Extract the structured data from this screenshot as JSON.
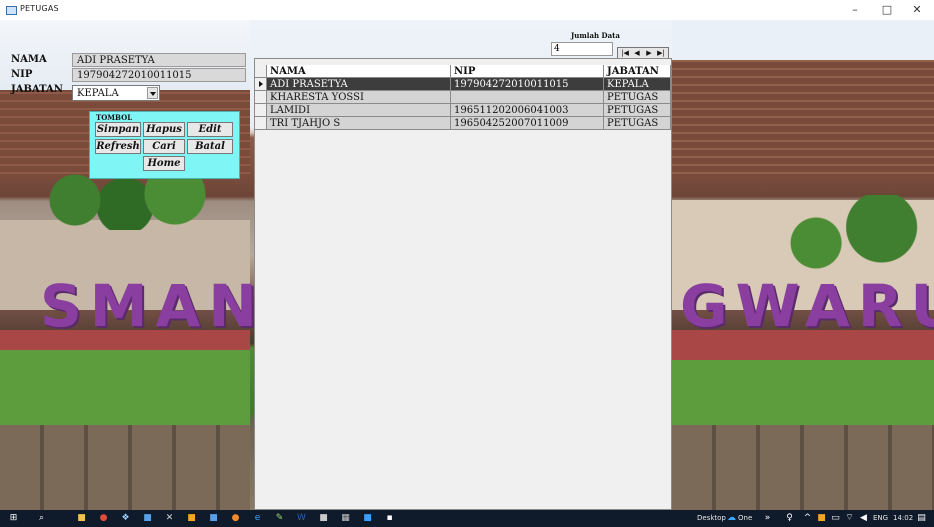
{
  "window": {
    "title": "PETUGAS"
  },
  "form": {
    "nama_label": "NAMA",
    "nama_value": "ADI PRASETYA",
    "nip_label": "NIP",
    "nip_value": "197904272010011015",
    "jabatan_label": "JABATAN",
    "jabatan_value": "KEPALA"
  },
  "tombol": {
    "caption": "TOMBOL",
    "simpan": "Simpan",
    "hapus": "Hapus",
    "edit": "Edit",
    "refresh": "Refresh",
    "cari": "Cari",
    "batal": "Batal",
    "home": "Home"
  },
  "jumlah": {
    "label": "Jumlah Data",
    "value": "4"
  },
  "grid": {
    "headers": [
      "NAMA",
      "NIP",
      "JABATAN"
    ],
    "rows": [
      [
        "ADI PRASETYA",
        "197904272010011015",
        "KEPALA"
      ],
      [
        "KHARESTA YOSSI",
        "",
        "PETUGAS"
      ],
      [
        "LAMIDI",
        "196511202006041003",
        "PETUGAS"
      ],
      [
        "TRI TJAHJO S",
        "196504252007011009",
        "PETUGAS"
      ]
    ]
  },
  "background_sign": {
    "left": "SMAN",
    "right": "GWARU"
  },
  "taskbar": {
    "desktop_label": "Desktop",
    "onedrive_label": "One",
    "language": "ENG",
    "time": "14:02"
  },
  "colors": {
    "button_panel": "#7ff5f5",
    "selected_row": "#3d3d3d",
    "taskbar": "#0f1a2b"
  },
  "icons": [
    "window-icon",
    "minimize-icon",
    "maximize-icon",
    "close-icon",
    "windows-start-icon",
    "search-icon",
    "first-record-icon",
    "prev-record-icon",
    "next-record-icon",
    "last-record-icon",
    "row-indicator-icon",
    "dropdown-arrow-icon"
  ]
}
